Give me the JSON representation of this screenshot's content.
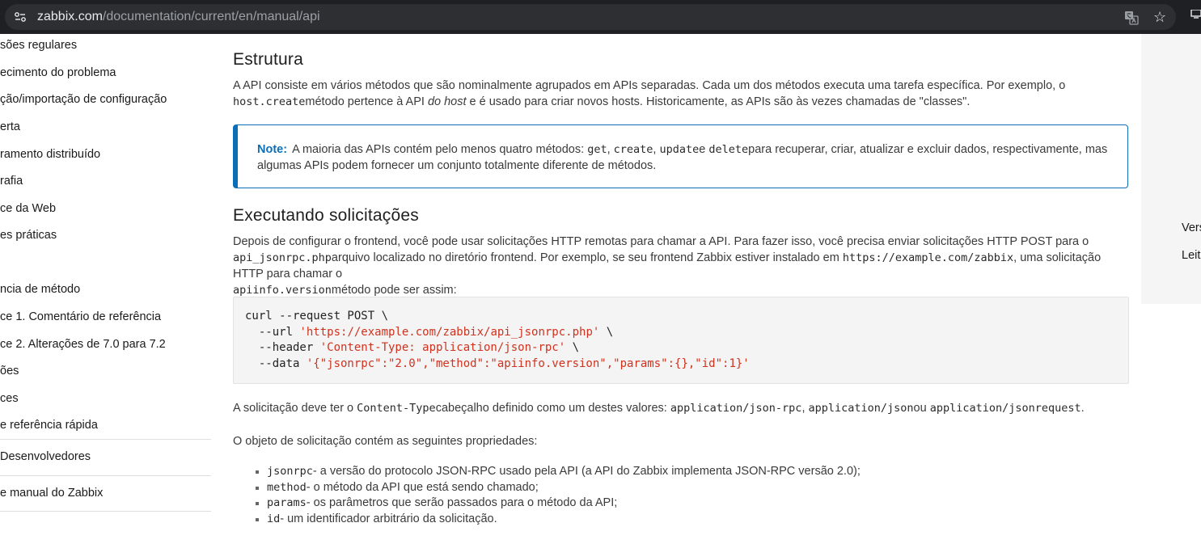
{
  "browser": {
    "url_host": "zabbix.com",
    "url_path": "/documentation/current/en/manual/api"
  },
  "sidebar": {
    "items": [
      "sões regulares",
      "ecimento do problema",
      "ção/importação de configuração",
      "erta",
      "ramento distribuído",
      "rafia",
      "ce da Web",
      "es práticas",
      "ncia de método",
      "ce 1. Comentário de referência",
      "ce 2. Alterações de 7.0 para 7.2",
      "ões",
      "ces",
      "e referência rápida"
    ],
    "developers": "Desenvolvedores",
    "manual": "e manual do Zabbix"
  },
  "main": {
    "heading_structure": "Estrutura",
    "structure_p1": "A API consiste em vários métodos que são nominalmente agrupados em APIs separadas. Cada um dos métodos executa uma tarefa específica. Por exemplo, o",
    "structure_code": "host.create",
    "structure_p2": "método pertence à API ",
    "structure_em": "do host",
    "structure_p3": " e é usado para criar novos hosts. Historicamente, as APIs são às vezes chamadas de \"classes\".",
    "note": {
      "label": "Note:",
      "t1": "A maioria das APIs contém pelo menos quatro métodos: ",
      "c1": "get",
      "t2": ", ",
      "c2": "create",
      "t3": ", ",
      "c3": "update",
      "t4": "e ",
      "c4": "delete",
      "t5": "para recuperar, criar, atualizar e excluir dados, respectivamente, mas algumas APIs podem fornecer um conjunto totalmente diferente de métodos."
    },
    "heading_requests": "Executando solicitações",
    "req_t1": "Depois de configurar o frontend, você pode usar solicitações HTTP remotas para chamar a API. Para fazer isso, você precisa enviar solicitações HTTP POST para o ",
    "req_c1": "api_jsonrpc.php",
    "req_t2": "arquivo localizado no diretório frontend. Por exemplo, se seu frontend Zabbix estiver instalado em ",
    "req_c2": "https://example.com/zabbix",
    "req_t3": ", uma solicitação HTTP para chamar o ",
    "req_c3": "apiinfo.version",
    "req_t4": "método pode ser assim:",
    "code": {
      "l1": "curl --request POST \\",
      "l2_pre": "  --url ",
      "l2_str": "'https://example.com/zabbix/api_jsonrpc.php'",
      "l2_post": " \\",
      "l3_pre": "  --header ",
      "l3_str": "'Content-Type: application/json-rpc'",
      "l3_post": " \\",
      "l4_pre": "  --data ",
      "l4_str": "'{\"jsonrpc\":\"2.0\",\"method\":\"apiinfo.version\",\"params\":{},\"id\":1}'"
    },
    "ct_t1": "A solicitação deve ter o ",
    "ct_c1": "Content-Type",
    "ct_t2": "cabeçalho definido como um destes valores: ",
    "ct_c2": "application/json-rpc",
    "ct_t3": ", ",
    "ct_c3": "application/json",
    "ct_t4": "ou ",
    "ct_c4": "application/jsonrequest",
    "ct_t5": ".",
    "props_intro": "O objeto de solicitação contém as seguintes propriedades:",
    "props": [
      {
        "code": "jsonrpc",
        "text": "- a versão do protocolo JSON-RPC usado pela API (a API do Zabbix implementa JSON-RPC versão 2.0);"
      },
      {
        "code": "method",
        "text": "- o método da API que está sendo chamado;"
      },
      {
        "code": "params",
        "text": "- os parâmetros que serão passados para o método da API;"
      },
      {
        "code": "id",
        "text": "- um identificador arbitrário da solicitação."
      }
    ]
  },
  "right_panel": {
    "item1": "Vers",
    "item2": "Leit"
  }
}
